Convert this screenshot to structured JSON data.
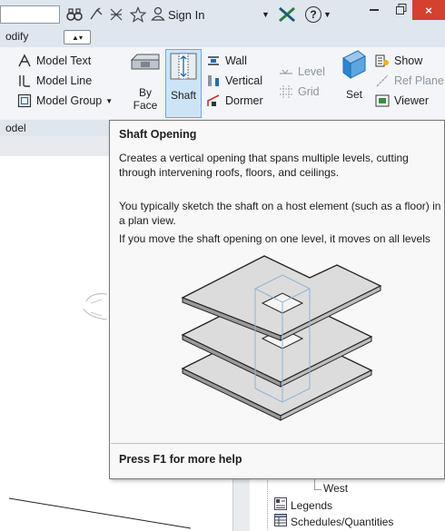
{
  "titlebar": {
    "sign_in_label": "Sign In",
    "help_symbol": "?",
    "close_symbol": "×"
  },
  "tabs": {
    "modify_label": "odify"
  },
  "ribbon": {
    "model_text": "Model Text",
    "model_line": "Model Line",
    "model_group": "Model Group",
    "by_label": "By",
    "face_label": "Face",
    "shaft_label": "Shaft",
    "wall_label": "Wall",
    "vertical_label": "Vertical",
    "dormer_label": "Dormer",
    "level_label": "Level",
    "grid_label": "Grid",
    "set_label": "Set",
    "show_label": "Show",
    "ref_plane_label": "Ref Plane",
    "viewer_label": "Viewer"
  },
  "panels": {
    "model_label": "odel"
  },
  "tooltip": {
    "title": "Shaft Opening",
    "p1": "Creates a vertical opening that spans multiple levels, cutting through intervening roofs, floors, and ceilings.",
    "p2": "You typically sketch the shaft on a host element (such as a floor) in a plan view.",
    "p3": "If you move the shaft opening on one level, it moves on all levels",
    "footer": "Press F1 for more help"
  },
  "browser": {
    "west": "West",
    "legends": "Legends",
    "schedules": "Schedules/Quantities"
  },
  "colors": {
    "accent": "#cde4f7",
    "close": "#d4412f",
    "ribbon_bg": "#f3f5f8"
  }
}
